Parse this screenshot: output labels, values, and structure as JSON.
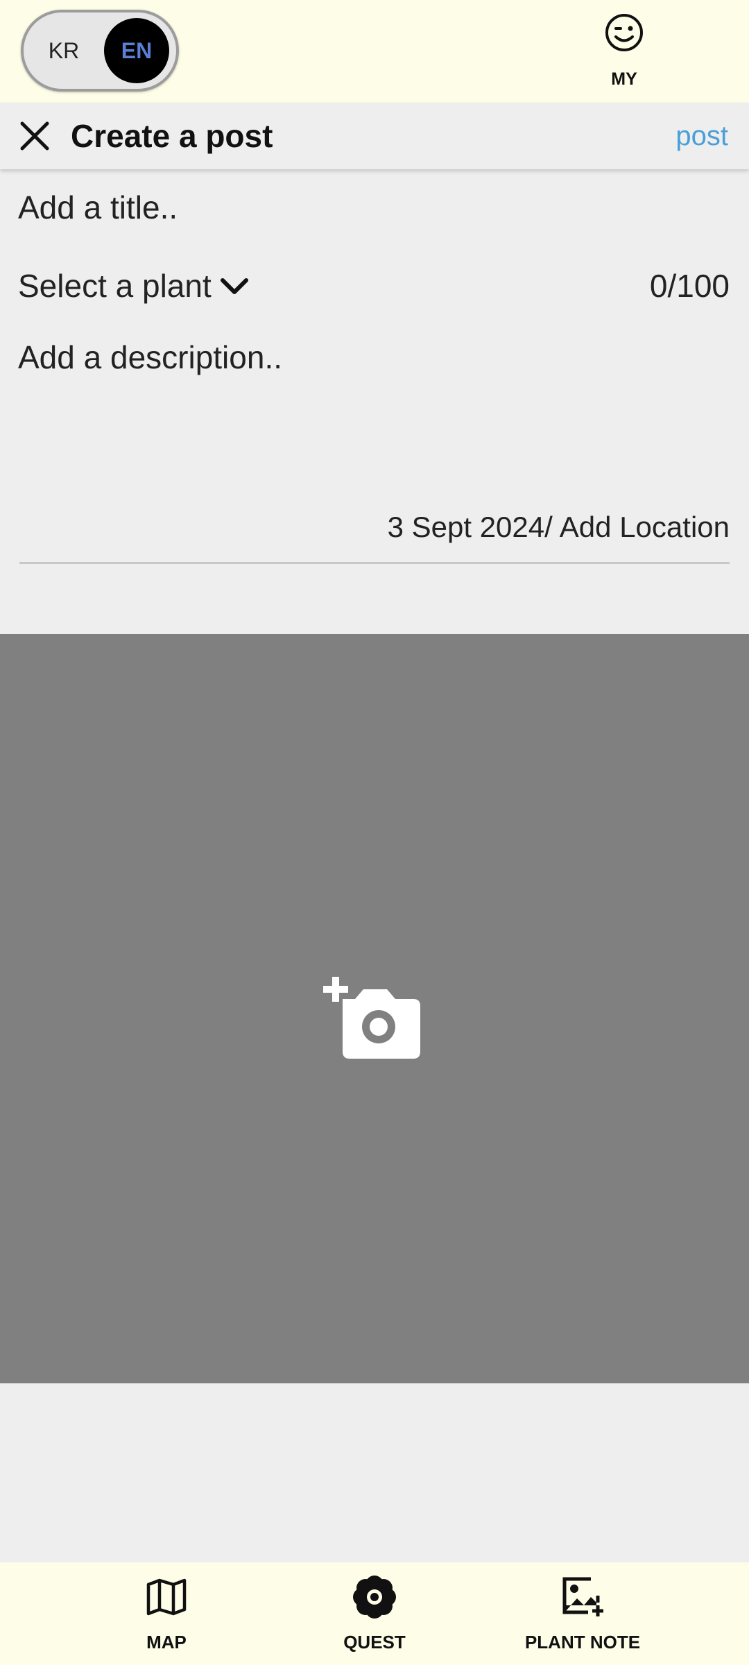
{
  "top_bar": {
    "language_toggle": {
      "options": [
        "KR",
        "EN"
      ],
      "selected": "EN"
    },
    "my_label": "MY"
  },
  "header": {
    "title": "Create a post",
    "post_label": "post"
  },
  "form": {
    "title_placeholder": "Add a title..",
    "plant_select_label": "Select a plant",
    "char_count": "0/100",
    "description_placeholder": "Add a description..",
    "date": "3 Sept 2024/",
    "location_label": "Add Location"
  },
  "photo": {
    "icon": "add-photo-icon"
  },
  "bottom_nav": {
    "items": [
      {
        "label": "MAP",
        "icon": "map-icon"
      },
      {
        "label": "QUEST",
        "icon": "flower-icon"
      },
      {
        "label": "PLANT NOTE",
        "icon": "add-image-icon"
      }
    ]
  },
  "colors": {
    "bar_background": "#fdfde8",
    "page_background": "#eeeeee",
    "photo_background": "#808080",
    "accent_link": "#4a9fd8",
    "toggle_selected_text": "#5b7fd6"
  }
}
